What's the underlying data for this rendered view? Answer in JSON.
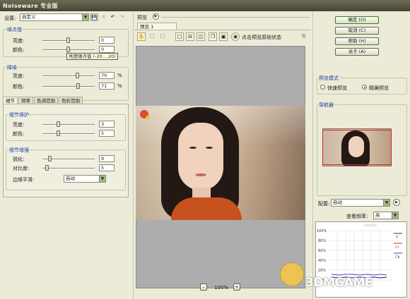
{
  "title": "Noiseware 专业版",
  "settings": {
    "label": "设置:",
    "preset": "自定义"
  },
  "noise": {
    "title": "噪点值",
    "luma_label": "亮度:",
    "luma_value": "0",
    "color_label": "颜色:",
    "color_value": "0",
    "tooltip": "亮度噪点值 (-20....20)"
  },
  "reduce": {
    "title": "降噪",
    "luma_label": "亮度:",
    "luma_value": "70",
    "luma_unit": "%",
    "color_label": "颜色:",
    "color_value": "71",
    "color_unit": "%"
  },
  "tabs": [
    "细节",
    "频率",
    "色调范围",
    "色彩范围"
  ],
  "detail_protect": {
    "title": "细节保护",
    "luma_label": "亮度:",
    "luma_value": "3",
    "color_label": "颜色:",
    "color_value": "5"
  },
  "detail_enhance": {
    "title": "细节增强",
    "sharpen_label": "锐化:",
    "sharpen_value": "9",
    "contrast_label": "对比度:",
    "contrast_value": "5",
    "edge_label": "边缘平滑:",
    "edge_value": "自动"
  },
  "preview": {
    "label": "预览",
    "tab": "预览 1",
    "toggle_hint": "点击预览原始状态",
    "zoom": "100%",
    "zoom_minus": "-",
    "zoom_plus": "+"
  },
  "actions": {
    "ok": "确定 (O)",
    "cancel": "取消 (C)",
    "help": "帮助 (H)",
    "about": "关于 (A)"
  },
  "preview_mode": {
    "title": "预览模式",
    "fast": "快速预览",
    "accurate": "精确预览",
    "selected": "accurate"
  },
  "navigator": {
    "title": "导航器"
  },
  "config": {
    "label": "配置:",
    "value": "自动",
    "freq_label": "查看频率:",
    "freq_value": "高",
    "graph_watermark": "Intellifr",
    "y_labels": [
      "100%",
      "80%",
      "60%",
      "40%",
      "20%",
      "0%"
    ],
    "legend": [
      "Y",
      "Cr",
      "Cb"
    ]
  },
  "watermark": "3DMGAME",
  "colors": {
    "accent": "#1c3fa6",
    "ok_border": "#3a7a2a",
    "graph_y": "#333333",
    "graph_cr": "#cc3333",
    "graph_cb": "#3344cc"
  }
}
